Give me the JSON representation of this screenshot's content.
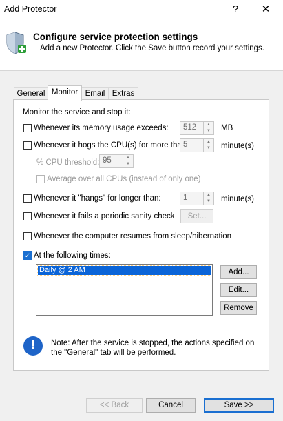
{
  "window": {
    "title": "Add Protector",
    "help_label": "?",
    "close_label": "✕"
  },
  "header": {
    "title": "Configure service protection settings",
    "subtitle": "Add a new Protector. Click the Save button record your settings.",
    "icon": "shield-plus-icon"
  },
  "tabs": [
    {
      "label": "General",
      "selected": false
    },
    {
      "label": "Monitor",
      "selected": true
    },
    {
      "label": "Email",
      "selected": false
    },
    {
      "label": "Extras",
      "selected": false
    }
  ],
  "monitor": {
    "intro": "Monitor the service and stop it:",
    "memory": {
      "label": "Whenever its memory usage exceeds:",
      "checked": false,
      "value": "512",
      "unit": "MB"
    },
    "cpu": {
      "label": "Whenever it hogs the CPU(s) for more than:",
      "checked": false,
      "value": "5",
      "unit": "minute(s)"
    },
    "cpu_threshold": {
      "label": "% CPU threshold:",
      "value": "95",
      "enabled": false
    },
    "average": {
      "label": "Average over all CPUs (instead of only one)",
      "checked": false,
      "enabled": false
    },
    "hangs": {
      "label": "Whenever it \"hangs\" for longer than:",
      "checked": false,
      "value": "1",
      "unit": "minute(s)"
    },
    "sanity": {
      "label": "Whenever it fails a periodic sanity check",
      "checked": false,
      "set_label": "Set..."
    },
    "resume": {
      "label": "Whenever the computer resumes from sleep/hibernation",
      "checked": false
    },
    "times": {
      "label": "At the following times:",
      "checked": true,
      "items": [
        "Daily @ 2 AM"
      ],
      "add_label": "Add...",
      "edit_label": "Edit...",
      "remove_label": "Remove"
    },
    "note": "Note: After the service is stopped, the actions specified on the \"General\" tab will be performed."
  },
  "footer": {
    "back_label": "<< Back",
    "cancel_label": "Cancel",
    "save_label": "Save >>"
  },
  "colors": {
    "accent": "#1a6fd1",
    "selection": "#0a64d8",
    "info": "#1e64c8"
  }
}
